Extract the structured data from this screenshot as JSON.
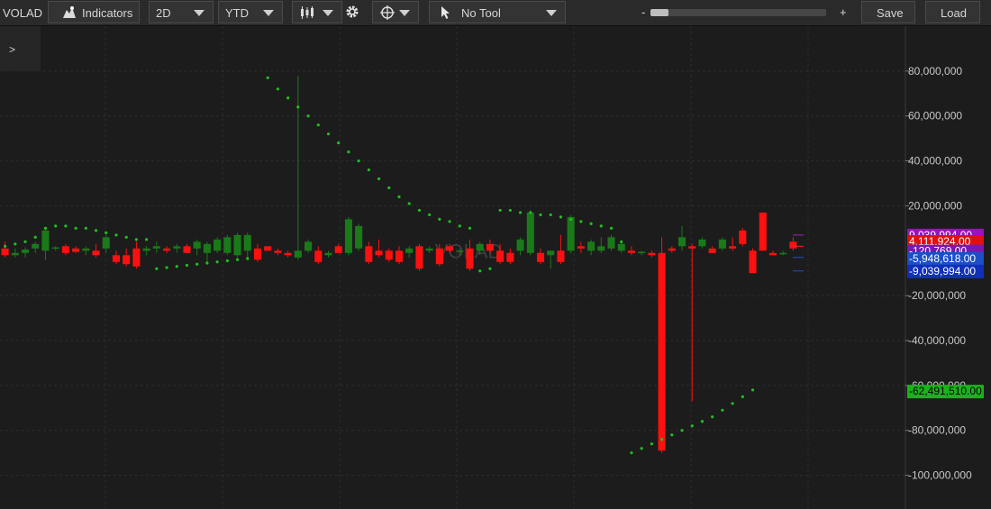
{
  "toolbar": {
    "symbol": "VOLAD",
    "indicators_label": "Indicators",
    "interval": "2D",
    "range": "YTD",
    "tool": "No Tool",
    "zoom_minus": "-",
    "zoom_plus": "+",
    "zoom_level": 0.1,
    "save_label": "Save",
    "load_label": "Load"
  },
  "panel_toggle": ">",
  "colors": {
    "up": "#1a7a1a",
    "down": "#ff1010",
    "sar": "#1fc01f",
    "grid": "#2c2c2c"
  },
  "chart_data": {
    "type": "candlestick",
    "watermark": "VOLAD",
    "ylim": [
      -115000000,
      100000000
    ],
    "y_ticks": [
      80000000,
      60000000,
      40000000,
      20000000,
      -20000000,
      -40000000,
      -60000000,
      -80000000,
      -100000000
    ],
    "y_tick_labels": [
      "80,000,000",
      "60,000,000",
      "40,000,000",
      "20,000,000",
      "-20,000,000",
      "-40,000,000",
      "-60,000,000",
      "-80,000,000",
      "-100,000,000"
    ],
    "candles": [
      {
        "o": 1000000,
        "h": 4000000,
        "l": -3000000,
        "c": -2000000
      },
      {
        "o": -2000000,
        "h": 1000000,
        "l": -3000000,
        "c": -1000000
      },
      {
        "o": -1000000,
        "h": 1500000,
        "l": -3000000,
        "c": 500000
      },
      {
        "o": 1000000,
        "h": 4000000,
        "l": -1000000,
        "c": 3000000
      },
      {
        "o": 0,
        "h": 10000000,
        "l": -4000000,
        "c": 9000000
      },
      {
        "o": 1000000,
        "h": 2000000,
        "l": 0,
        "c": 1500000
      },
      {
        "o": 2000000,
        "h": 3000000,
        "l": -2000000,
        "c": -1000000
      },
      {
        "o": 1000000,
        "h": 2000000,
        "l": -1000000,
        "c": -500000
      },
      {
        "o": 0,
        "h": 2000000,
        "l": -2000000,
        "c": 1000000
      },
      {
        "o": 0,
        "h": 3000000,
        "l": -3000000,
        "c": -2000000
      },
      {
        "o": 1000000,
        "h": 7000000,
        "l": -1000000,
        "c": 6000000
      },
      {
        "o": -2000000,
        "h": 0,
        "l": -6000000,
        "c": -5000000
      },
      {
        "o": -2000000,
        "h": 1000000,
        "l": -7000000,
        "c": -6000000
      },
      {
        "o": 1000000,
        "h": 4000000,
        "l": -8000000,
        "c": -7000000
      },
      {
        "o": 0,
        "h": 2000000,
        "l": -2000000,
        "c": 1000000
      },
      {
        "o": 1000000,
        "h": 4000000,
        "l": -1000000,
        "c": 2000000
      },
      {
        "o": 1000000,
        "h": 2000000,
        "l": -1000000,
        "c": 0
      },
      {
        "o": 1000000,
        "h": 3000000,
        "l": -1000000,
        "c": 2000000
      },
      {
        "o": 2000000,
        "h": 3000000,
        "l": -1000000,
        "c": -1000000
      },
      {
        "o": 1000000,
        "h": 5000000,
        "l": -2000000,
        "c": 4000000
      },
      {
        "o": -1000000,
        "h": 4000000,
        "l": -6000000,
        "c": 3000000
      },
      {
        "o": 0,
        "h": 6000000,
        "l": -1000000,
        "c": 5000000
      },
      {
        "o": -1000000,
        "h": 7000000,
        "l": -2000000,
        "c": 6000000
      },
      {
        "o": -2000000,
        "h": 8000000,
        "l": -3000000,
        "c": 7000000
      },
      {
        "o": 0,
        "h": 8000000,
        "l": -4000000,
        "c": 7000000
      },
      {
        "o": 1000000,
        "h": 3000000,
        "l": -5000000,
        "c": -4000000
      },
      {
        "o": 2000000,
        "h": 1000000,
        "l": 0,
        "c": 0
      },
      {
        "o": 0,
        "h": 1000000,
        "l": -2000000,
        "c": -1000000
      },
      {
        "o": -1000000,
        "h": 0,
        "l": -3000000,
        "c": -2000000
      },
      {
        "o": -3000000,
        "h": 78000000,
        "l": -4000000,
        "c": 0
      },
      {
        "o": 0,
        "h": 5000000,
        "l": -1000000,
        "c": 4000000
      },
      {
        "o": 0,
        "h": 2000000,
        "l": -6000000,
        "c": -5000000
      },
      {
        "o": -2000000,
        "h": 0,
        "l": -3000000,
        "c": -1000000
      },
      {
        "o": 2000000,
        "h": 3000000,
        "l": -1000000,
        "c": -1000000
      },
      {
        "o": -1000000,
        "h": 15000000,
        "l": -2000000,
        "c": 14000000
      },
      {
        "o": 1000000,
        "h": 12000000,
        "l": 0,
        "c": 11000000
      },
      {
        "o": 2000000,
        "h": 4000000,
        "l": -6000000,
        "c": -5000000
      },
      {
        "o": 0,
        "h": 5000000,
        "l": -3000000,
        "c": -2000000
      },
      {
        "o": 0,
        "h": 1000000,
        "l": -5000000,
        "c": -4000000
      },
      {
        "o": 0,
        "h": 2000000,
        "l": -6000000,
        "c": -5000000
      },
      {
        "o": -1000000,
        "h": 2000000,
        "l": -3000000,
        "c": 1000000
      },
      {
        "o": 2000000,
        "h": 3000000,
        "l": -9000000,
        "c": -8000000
      },
      {
        "o": 0,
        "h": 2000000,
        "l": -1000000,
        "c": 1000000
      },
      {
        "o": 1000000,
        "h": 3000000,
        "l": -7000000,
        "c": -6000000
      },
      {
        "o": 2000000,
        "h": 3000000,
        "l": -1000000,
        "c": 0
      },
      {
        "o": 0,
        "h": 1000000,
        "l": -2000000,
        "c": 0
      },
      {
        "o": 1000000,
        "h": 5000000,
        "l": -9000000,
        "c": -8000000
      },
      {
        "o": 0,
        "h": 4000000,
        "l": -2000000,
        "c": 3000000
      },
      {
        "o": 3000000,
        "h": 5000000,
        "l": -1000000,
        "c": 0
      },
      {
        "o": 0,
        "h": 3000000,
        "l": -6000000,
        "c": -5000000
      },
      {
        "o": -1000000,
        "h": 1000000,
        "l": -6000000,
        "c": -5000000
      },
      {
        "o": 0,
        "h": 6000000,
        "l": -2000000,
        "c": 5000000
      },
      {
        "o": -1000000,
        "h": 18000000,
        "l": -2000000,
        "c": 17000000
      },
      {
        "o": -1000000,
        "h": 1000000,
        "l": -6000000,
        "c": -5000000
      },
      {
        "o": -2000000,
        "h": 0,
        "l": -8000000,
        "c": 0
      },
      {
        "o": 0,
        "h": 7000000,
        "l": -6000000,
        "c": -5000000
      },
      {
        "o": 0,
        "h": 16000000,
        "l": -1000000,
        "c": 15000000
      },
      {
        "o": 2000000,
        "h": 4000000,
        "l": -1000000,
        "c": 1000000
      },
      {
        "o": 0,
        "h": 5000000,
        "l": -2000000,
        "c": 4000000
      },
      {
        "o": 0,
        "h": 6000000,
        "l": -1000000,
        "c": 2000000
      },
      {
        "o": 1000000,
        "h": 7000000,
        "l": 0,
        "c": 6000000
      },
      {
        "o": 0,
        "h": 4000000,
        "l": -1000000,
        "c": 3000000
      },
      {
        "o": 0,
        "h": 2000000,
        "l": -2000000,
        "c": -1000000
      },
      {
        "o": -1000000,
        "h": 0,
        "l": -2000000,
        "c": -500000
      },
      {
        "o": -1000000,
        "h": 0,
        "l": -3000000,
        "c": -2000000
      },
      {
        "o": -1000000,
        "h": 6000000,
        "l": -90000000,
        "c": -89000000
      },
      {
        "o": 1000000,
        "h": 2000000,
        "l": -1000000,
        "c": 0
      },
      {
        "o": 2000000,
        "h": 11000000,
        "l": 0,
        "c": 6000000
      },
      {
        "o": 2000000,
        "h": 3000000,
        "l": -67000000,
        "c": 1000000
      },
      {
        "o": 2000000,
        "h": 6000000,
        "l": 1000000,
        "c": 5000000
      },
      {
        "o": 1000000,
        "h": 2000000,
        "l": -1000000,
        "c": -1000000
      },
      {
        "o": 1000000,
        "h": 6000000,
        "l": 0,
        "c": 5000000
      },
      {
        "o": 2000000,
        "h": 6000000,
        "l": 0,
        "c": 1000000
      },
      {
        "o": 9000000,
        "h": 10000000,
        "l": 2000000,
        "c": 3000000
      },
      {
        "o": 0,
        "h": 1000000,
        "l": -10000000,
        "c": -10000000
      },
      {
        "o": 17000000,
        "h": 17000000,
        "l": 0,
        "c": 0
      },
      {
        "o": -1000000,
        "h": 0,
        "l": -2000000,
        "c": -2000000
      },
      {
        "o": -1000000,
        "h": 0,
        "l": -2000000,
        "c": -1000000
      },
      {
        "o": 4000000,
        "h": 6000000,
        "l": 0,
        "c": 1000000
      }
    ],
    "sar": [
      {
        "i": 0,
        "v": 2000000
      },
      {
        "i": 1,
        "v": 3000000
      },
      {
        "i": 2,
        "v": 4000000
      },
      {
        "i": 3,
        "v": 6000000
      },
      {
        "i": 4,
        "v": 10000000
      },
      {
        "i": 5,
        "v": 11000000
      },
      {
        "i": 6,
        "v": 11000000
      },
      {
        "i": 7,
        "v": 10000000
      },
      {
        "i": 8,
        "v": 10000000
      },
      {
        "i": 9,
        "v": 9000000
      },
      {
        "i": 10,
        "v": 8000000
      },
      {
        "i": 11,
        "v": 7000000
      },
      {
        "i": 12,
        "v": 6000000
      },
      {
        "i": 13,
        "v": 5000000
      },
      {
        "i": 14,
        "v": 5000000
      },
      {
        "i": 15,
        "v": -8000000
      },
      {
        "i": 16,
        "v": -7500000
      },
      {
        "i": 17,
        "v": -7000000
      },
      {
        "i": 18,
        "v": -6500000
      },
      {
        "i": 19,
        "v": -6000000
      },
      {
        "i": 20,
        "v": -5500000
      },
      {
        "i": 21,
        "v": -5000000
      },
      {
        "i": 22,
        "v": -4500000
      },
      {
        "i": 23,
        "v": -4000000
      },
      {
        "i": 24,
        "v": -3500000
      },
      {
        "i": 26,
        "v": 77000000
      },
      {
        "i": 27,
        "v": 72000000
      },
      {
        "i": 28,
        "v": 68000000
      },
      {
        "i": 29,
        "v": 64000000
      },
      {
        "i": 30,
        "v": 60000000
      },
      {
        "i": 31,
        "v": 56000000
      },
      {
        "i": 32,
        "v": 52000000
      },
      {
        "i": 33,
        "v": 48000000
      },
      {
        "i": 34,
        "v": 44000000
      },
      {
        "i": 35,
        "v": 40000000
      },
      {
        "i": 36,
        "v": 36000000
      },
      {
        "i": 37,
        "v": 32000000
      },
      {
        "i": 38,
        "v": 28000000
      },
      {
        "i": 39,
        "v": 24000000
      },
      {
        "i": 40,
        "v": 21000000
      },
      {
        "i": 41,
        "v": 18000000
      },
      {
        "i": 42,
        "v": 16000000
      },
      {
        "i": 43,
        "v": 14000000
      },
      {
        "i": 44,
        "v": 13000000
      },
      {
        "i": 45,
        "v": 11000000
      },
      {
        "i": 46,
        "v": 10000000
      },
      {
        "i": 47,
        "v": -9000000
      },
      {
        "i": 48,
        "v": -8000000
      },
      {
        "i": 49,
        "v": 18000000
      },
      {
        "i": 50,
        "v": 18000000
      },
      {
        "i": 51,
        "v": 17000000
      },
      {
        "i": 52,
        "v": 17000000
      },
      {
        "i": 53,
        "v": 16000000
      },
      {
        "i": 54,
        "v": 16000000
      },
      {
        "i": 55,
        "v": 15000000
      },
      {
        "i": 56,
        "v": 14000000
      },
      {
        "i": 57,
        "v": 13000000
      },
      {
        "i": 58,
        "v": 12000000
      },
      {
        "i": 59,
        "v": 11000000
      },
      {
        "i": 60,
        "v": 10000000
      },
      {
        "i": 61,
        "v": 4000000
      },
      {
        "i": 62,
        "v": -90000000
      },
      {
        "i": 63,
        "v": -88000000
      },
      {
        "i": 64,
        "v": -86000000
      },
      {
        "i": 65,
        "v": -84000000
      },
      {
        "i": 66,
        "v": -82000000
      },
      {
        "i": 67,
        "v": -80000000
      },
      {
        "i": 68,
        "v": -78000000
      },
      {
        "i": 69,
        "v": -76000000
      },
      {
        "i": 70,
        "v": -74000000
      },
      {
        "i": 71,
        "v": -71000000
      },
      {
        "i": 72,
        "v": -68000000
      },
      {
        "i": 73,
        "v": -65000000
      },
      {
        "i": 74,
        "v": -62000000
      }
    ],
    "price_tags": [
      {
        "label": "9,039,994.00",
        "value": 7000000,
        "bg": "#9a12b8",
        "fg": "#ffffff"
      },
      {
        "label": "4,111,924.00",
        "value": 4111924,
        "bg": "#e01010",
        "fg": "#ffffff"
      },
      {
        "label": "-120,769.00",
        "value": -120769,
        "bg": "#7a18b0",
        "fg": "#ffffff"
      },
      {
        "label": "-5,948,618.00",
        "value": -3500000,
        "bg": "#1a4fc8",
        "fg": "#ffffff"
      },
      {
        "label": "-9,039,994.00",
        "value": -9039994,
        "bg": "#1030b8",
        "fg": "#ffffff"
      },
      {
        "label": "-62,491,510.00",
        "value": -62491510,
        "bg": "#19b319",
        "fg": "#000000"
      }
    ]
  }
}
